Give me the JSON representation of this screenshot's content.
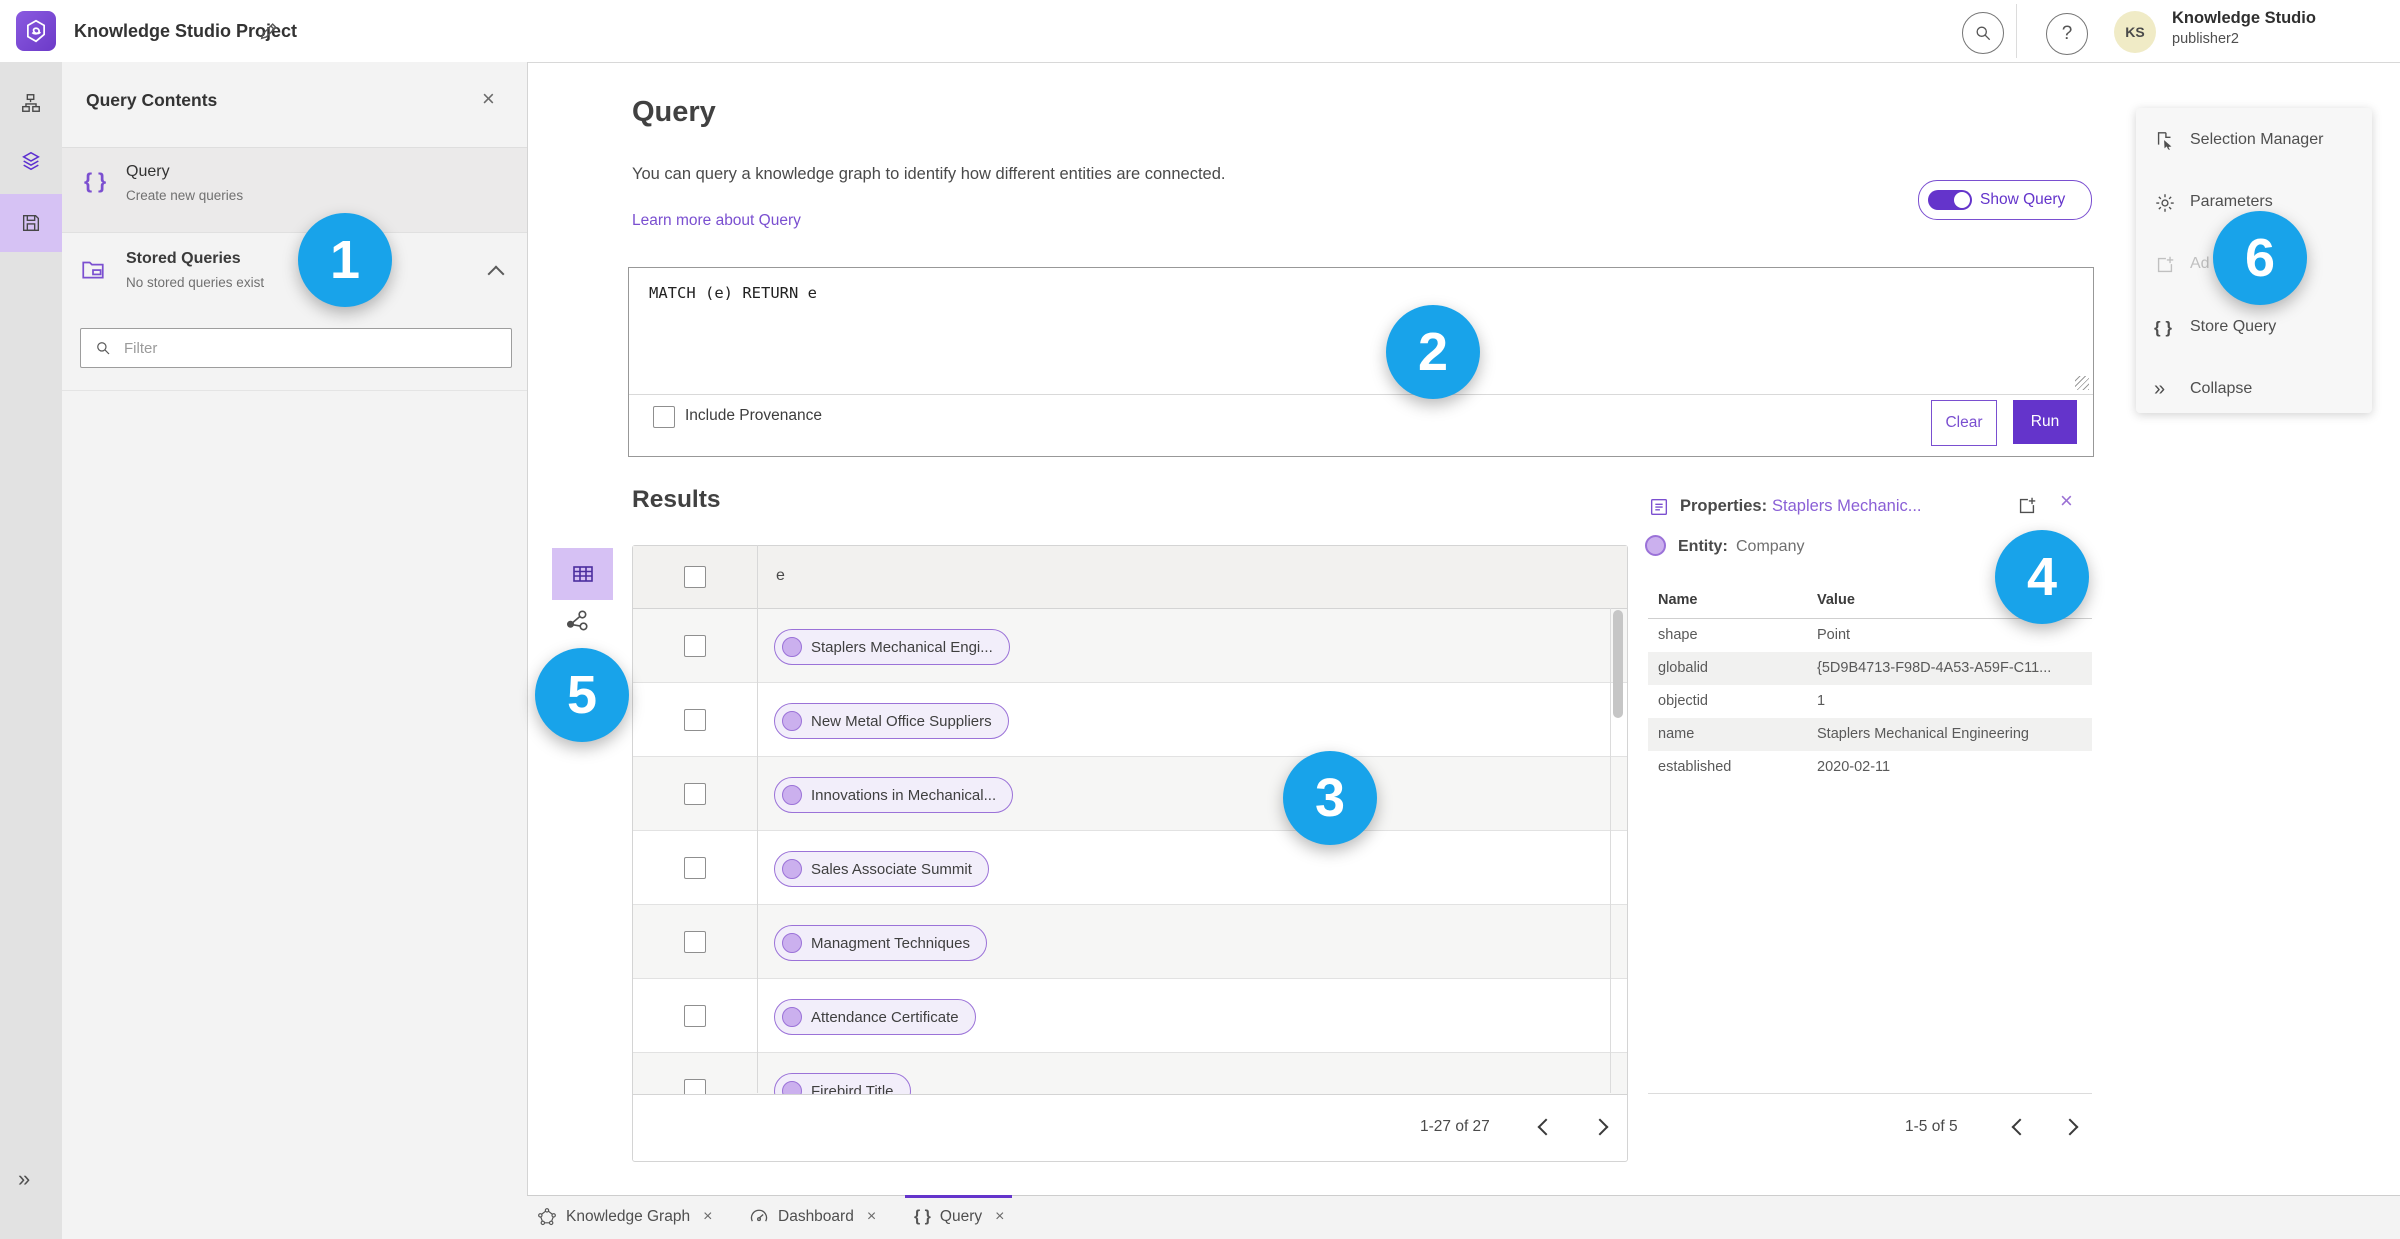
{
  "topbar": {
    "title": "Knowledge Studio Project",
    "user": {
      "name": "Knowledge Studio",
      "role": "publisher2",
      "initials": "KS"
    }
  },
  "contents": {
    "title": "Query Contents",
    "query_item": {
      "label": "Query",
      "sublabel": "Create new queries"
    },
    "stored_item": {
      "label": "Stored Queries",
      "sublabel": "No stored queries exist"
    },
    "filter_placeholder": "Filter"
  },
  "query": {
    "heading": "Query",
    "description": "You can query a knowledge graph to identify how different entities are connected.",
    "learn_more": "Learn more about Query",
    "show_query": "Show Query",
    "text": "MATCH (e) RETURN e",
    "include_provenance": "Include Provenance",
    "clear": "Clear",
    "run": "Run"
  },
  "results": {
    "heading": "Results",
    "column": "e",
    "rows": [
      "Staplers Mechanical Engi...",
      "New Metal Office Suppliers",
      "Innovations in Mechanical...",
      "Sales Associate Summit",
      "Managment Techniques",
      "Attendance Certificate",
      "Firebird Title"
    ],
    "pagination": "1-27 of 27"
  },
  "properties": {
    "label": "Properties:",
    "entity_name": "Staplers Mechanic...",
    "entity_label": "Entity:",
    "entity_type": "Company",
    "col_name": "Name",
    "col_value": "Value",
    "rows": [
      {
        "name": "shape",
        "value": "Point"
      },
      {
        "name": "globalid",
        "value": "{5D9B4713-F98D-4A53-A59F-C11..."
      },
      {
        "name": "objectid",
        "value": "1"
      },
      {
        "name": "name",
        "value": "Staplers Mechanical Engineering"
      },
      {
        "name": "established",
        "value": "2020-02-11"
      }
    ],
    "pagination": "1-5 of 5"
  },
  "right_panel": {
    "items": [
      {
        "label": "Selection Manager"
      },
      {
        "label": "Parameters"
      },
      {
        "label": "Ad",
        "disabled": true
      },
      {
        "label": "Store Query"
      },
      {
        "label": "Collapse"
      }
    ]
  },
  "tabs": [
    {
      "label": "Knowledge Graph"
    },
    {
      "label": "Dashboard"
    },
    {
      "label": "Query",
      "active": true
    }
  ],
  "badges": [
    "1",
    "2",
    "3",
    "4",
    "5",
    "6"
  ],
  "icons": {
    "close": "×",
    "question": "?",
    "braces": "{ }",
    "double_chevron": "»"
  },
  "colors": {
    "accent_purple": "#6434cb",
    "light_purple": "#d6c2f4",
    "badge_blue": "#18a3ea"
  }
}
